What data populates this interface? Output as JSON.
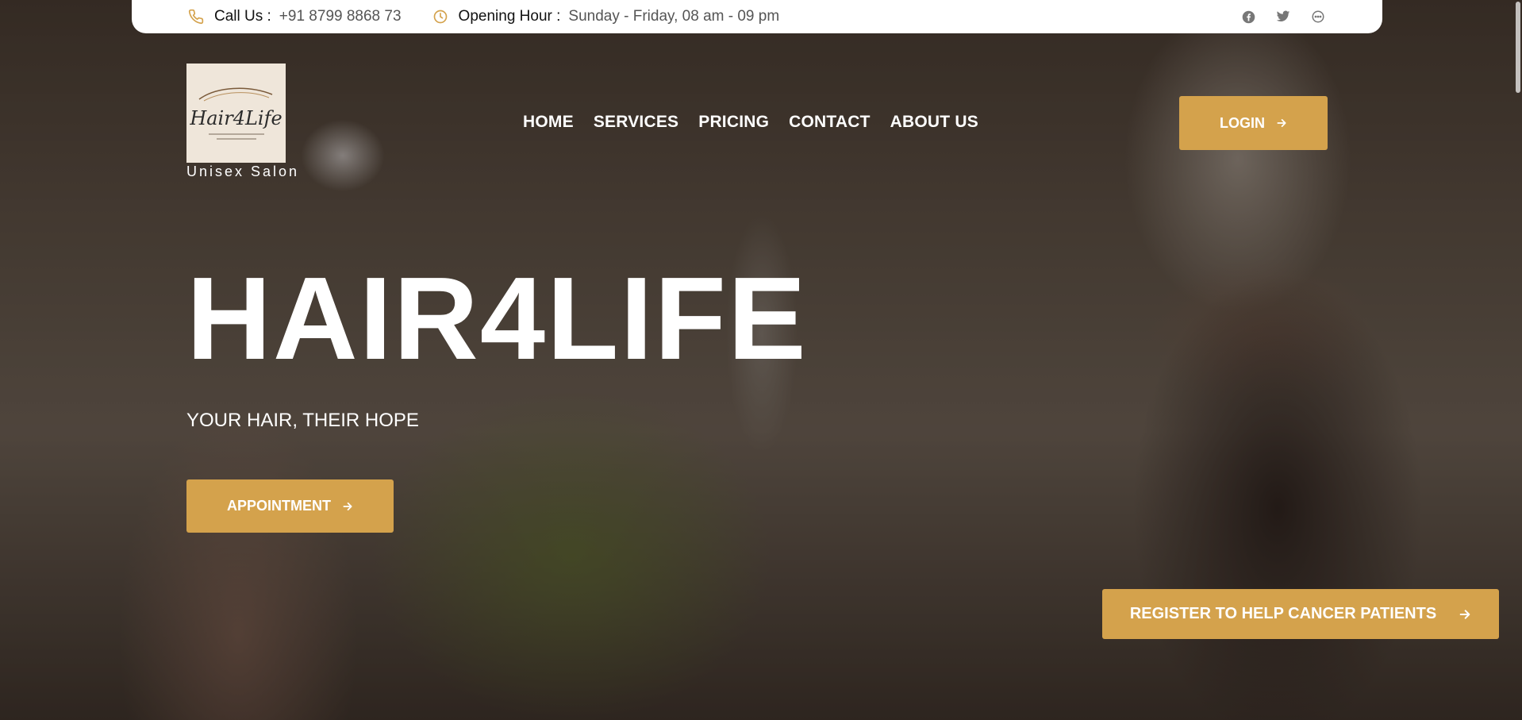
{
  "colors": {
    "accent": "#d4a24c",
    "topbar_bg": "#ffffff",
    "text_light": "#ffffff"
  },
  "topbar": {
    "call": {
      "icon": "phone-icon",
      "label": "Call Us :",
      "value": "+91 8799 8868 73"
    },
    "hours": {
      "icon": "clock-icon",
      "label": "Opening Hour :",
      "value": "Sunday - Friday, 08 am - 09 pm"
    },
    "social": [
      "facebook-icon",
      "twitter-icon",
      "chat-icon"
    ]
  },
  "brand": {
    "logo_text": "Hair4Life",
    "caption": "Unisex Salon"
  },
  "nav": {
    "items": [
      {
        "label": "HOME"
      },
      {
        "label": "SERVICES"
      },
      {
        "label": "PRICING"
      },
      {
        "label": "CONTACT"
      },
      {
        "label": "ABOUT US"
      }
    ],
    "login_label": "LOGIN"
  },
  "hero": {
    "title": "HAIR4LIFE",
    "subtitle": "YOUR HAIR, THEIR HOPE",
    "appointment_label": "APPOINTMENT",
    "register_label": "REGISTER TO HELP CANCER PATIENTS"
  }
}
